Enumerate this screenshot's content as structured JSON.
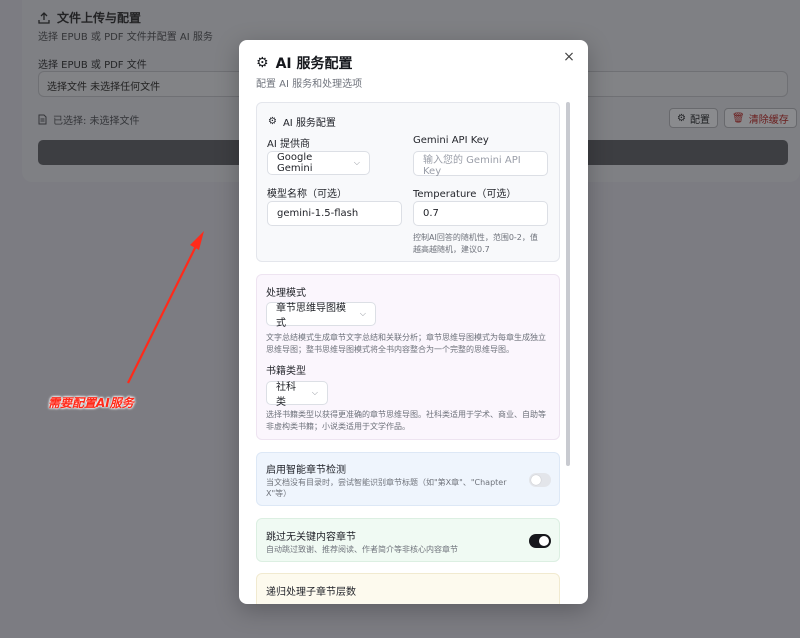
{
  "background": {
    "section_title": "文件上传与配置",
    "section_subtitle": "选择 EPUB 或 PDF 文件并配置 AI 服务",
    "file_label": "选择 EPUB 或 PDF 文件",
    "file_input_text": "选择文件 未选择任何文件",
    "selected_text": "已选择: 未选择文件",
    "config_button": "配置",
    "clear_cache_button": "清除缓存"
  },
  "annotation": {
    "text": "需要配置AI服务",
    "color": "#ff2a1a"
  },
  "modal": {
    "title": "AI 服务配置",
    "subtitle": "配置 AI 服务和处理选项",
    "close_symbol": "×",
    "ai_section": {
      "heading": "AI 服务配置",
      "provider_label": "AI 提供商",
      "provider_value": "Google Gemini",
      "api_key_label": "Gemini API Key",
      "api_key_placeholder": "输入您的 Gemini API Key",
      "model_label": "模型名称（可选）",
      "model_value": "gemini-1.5-flash",
      "temperature_label": "Temperature（可选）",
      "temperature_value": "0.7",
      "temperature_help_line1": "控制AI回答的随机性，范围0-2，值",
      "temperature_help_line2": "越高越随机，建议0.7"
    },
    "mode_section": {
      "heading": "处理模式",
      "mode_value": "章节思维导图模式",
      "mode_help_line1": "文字总结模式生成章节文字总结和关联分析；章节思维导图模式为每章生成独立",
      "mode_help_line2": "思维导图；整书思维导图模式将全书内容整合为一个完整的思维导图。",
      "book_type_label": "书籍类型",
      "book_type_value": "社科类",
      "book_type_help_line1": "选择书籍类型以获得更准确的章节思维导图。社科类适用于学术、商业、自助等",
      "book_type_help_line2": "非虚构类书籍；小说类适用于文学作品。"
    },
    "detect_section": {
      "title": "启用智能章节检测",
      "desc_line1": "当文档没有目录时，尝试智能识别章节标题（如\"第X章\"、\"Chapter",
      "desc_line2": "X\"等）",
      "enabled": false
    },
    "skip_section": {
      "title": "跳过无关键内容章节",
      "desc": "自动跳过致谢、推荐阅读、作者简介等非核心内容章节",
      "enabled": true
    },
    "recursion_section": {
      "title": "递归处理子章节层数"
    }
  }
}
